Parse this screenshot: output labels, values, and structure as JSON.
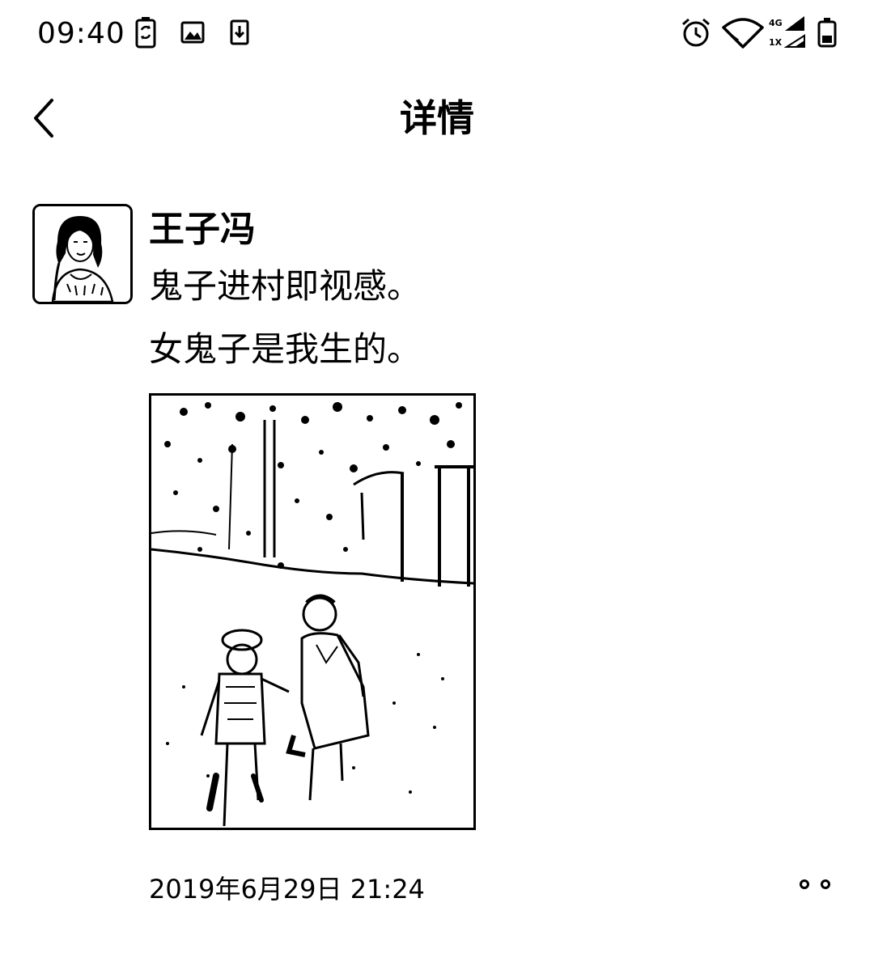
{
  "status_bar": {
    "time": "09:40",
    "network_top": "4G",
    "network_bottom": "1X",
    "icons": [
      "battery-sync-icon",
      "image-icon",
      "download-icon",
      "alarm-icon",
      "wifi-icon",
      "cellular-signal-icon",
      "battery-icon"
    ]
  },
  "nav": {
    "title": "详情",
    "back_icon": "chevron-left-icon"
  },
  "post": {
    "author": "王子冯",
    "lines": [
      "鬼子进村即视感。",
      "女鬼子是我生的。"
    ],
    "timestamp": "2019年6月29日 21:24",
    "more_icon": "more-dots-icon"
  }
}
